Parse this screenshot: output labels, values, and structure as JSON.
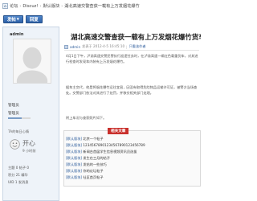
{
  "breadcrumb": {
    "items": [
      "论坛",
      "Discuz!",
      "默认版块"
    ],
    "current": "湖北高速交警查获一载有上万发烟花爆竹"
  },
  "toolbar": {
    "post_label": "发帖",
    "reply_label": "回复"
  },
  "author": {
    "name": "admin",
    "role_a": "管理员",
    "role_b": "管理员",
    "level_fraction": 0.6
  },
  "mood": {
    "label": "TA的每日心情",
    "text": "开心",
    "stat": "9 小时前"
  },
  "stats": [
    "主题 0 帖子 0",
    "积分 21 精华",
    "UID 1 发消息"
  ],
  "post": {
    "title": "湖北高速交警查获一载有上万发烟花爆竹货车",
    "author_link": "admin",
    "time": "发表于 2012-4-5 16:45:10",
    "sep": "|",
    "floor": "只看该作者",
    "paragraphs": [
      "4月1日下午，泸渝高速交警民警执行巡逻任务时，在泸渝高速一辆红色载重货车，对其进行检查时发现车内装有上万发烟花爆竹。",
      "据车主交代，他是将烟花爆竹运往宜昌，因没有取得危险物品运输许可证，被警方当场查处。交警部门依法对其进行了处罚，并移交相关部门处理。",
      "附上车况与查获照片如下。"
    ]
  },
  "recommended": {
    "header": "相关文章",
    "items": [
      {
        "tag": "[默认版块]",
        "text": "北京一个帖子"
      },
      {
        "tag": "[默认版块]",
        "text": "12345678901234567890123456789"
      },
      {
        "tag": "[默认版块]",
        "text": "新闻台首届学生信息视频资讯员选拔"
      },
      {
        "tag": "[默认版块]",
        "text": "发生在三月的帖子"
      },
      {
        "tag": "[默认版块]",
        "text": "发帖的一些技巧"
      },
      {
        "tag": "[默认版块]",
        "text": "你的论坛帖子"
      },
      {
        "tag": "[默认版块]",
        "text": "社区首页帖子"
      }
    ]
  }
}
